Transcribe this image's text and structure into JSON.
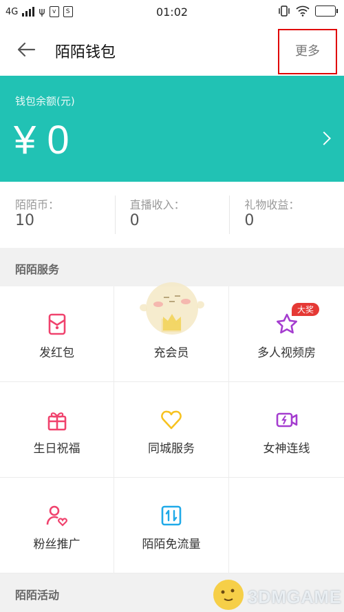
{
  "status_bar": {
    "network": "4G",
    "time": "01:02"
  },
  "header": {
    "title": "陌陌钱包",
    "more_label": "更多"
  },
  "balance": {
    "label": "钱包余额(元)",
    "amount": "¥ 0"
  },
  "stats": [
    {
      "label": "陌陌币：",
      "value": "10"
    },
    {
      "label": "直播收入：",
      "value": "0"
    },
    {
      "label": "礼物收益：",
      "value": "0"
    }
  ],
  "services_section": {
    "title": "陌陌服务",
    "items": [
      {
        "label": "发红包",
        "icon": "red-envelope-icon"
      },
      {
        "label": "充会员",
        "icon": "crown-icon"
      },
      {
        "label": "多人视频房",
        "icon": "star-icon",
        "badge": "大奖"
      },
      {
        "label": "生日祝福",
        "icon": "gift-icon"
      },
      {
        "label": "同城服务",
        "icon": "heart-icon"
      },
      {
        "label": "女神连线",
        "icon": "video-call-icon"
      },
      {
        "label": "粉丝推广",
        "icon": "user-heart-icon"
      },
      {
        "label": "陌陌免流量",
        "icon": "data-transfer-icon"
      }
    ]
  },
  "activities_section": {
    "title": "陌陌活动"
  },
  "watermark": {
    "text": "3DMGAME"
  },
  "colors": {
    "accent_teal": "#21c2b4",
    "pink": "#f0426d",
    "yellow": "#f7c21f",
    "purple": "#a43ccf",
    "blue": "#1fa9e8",
    "highlight_red": "#e00000"
  }
}
